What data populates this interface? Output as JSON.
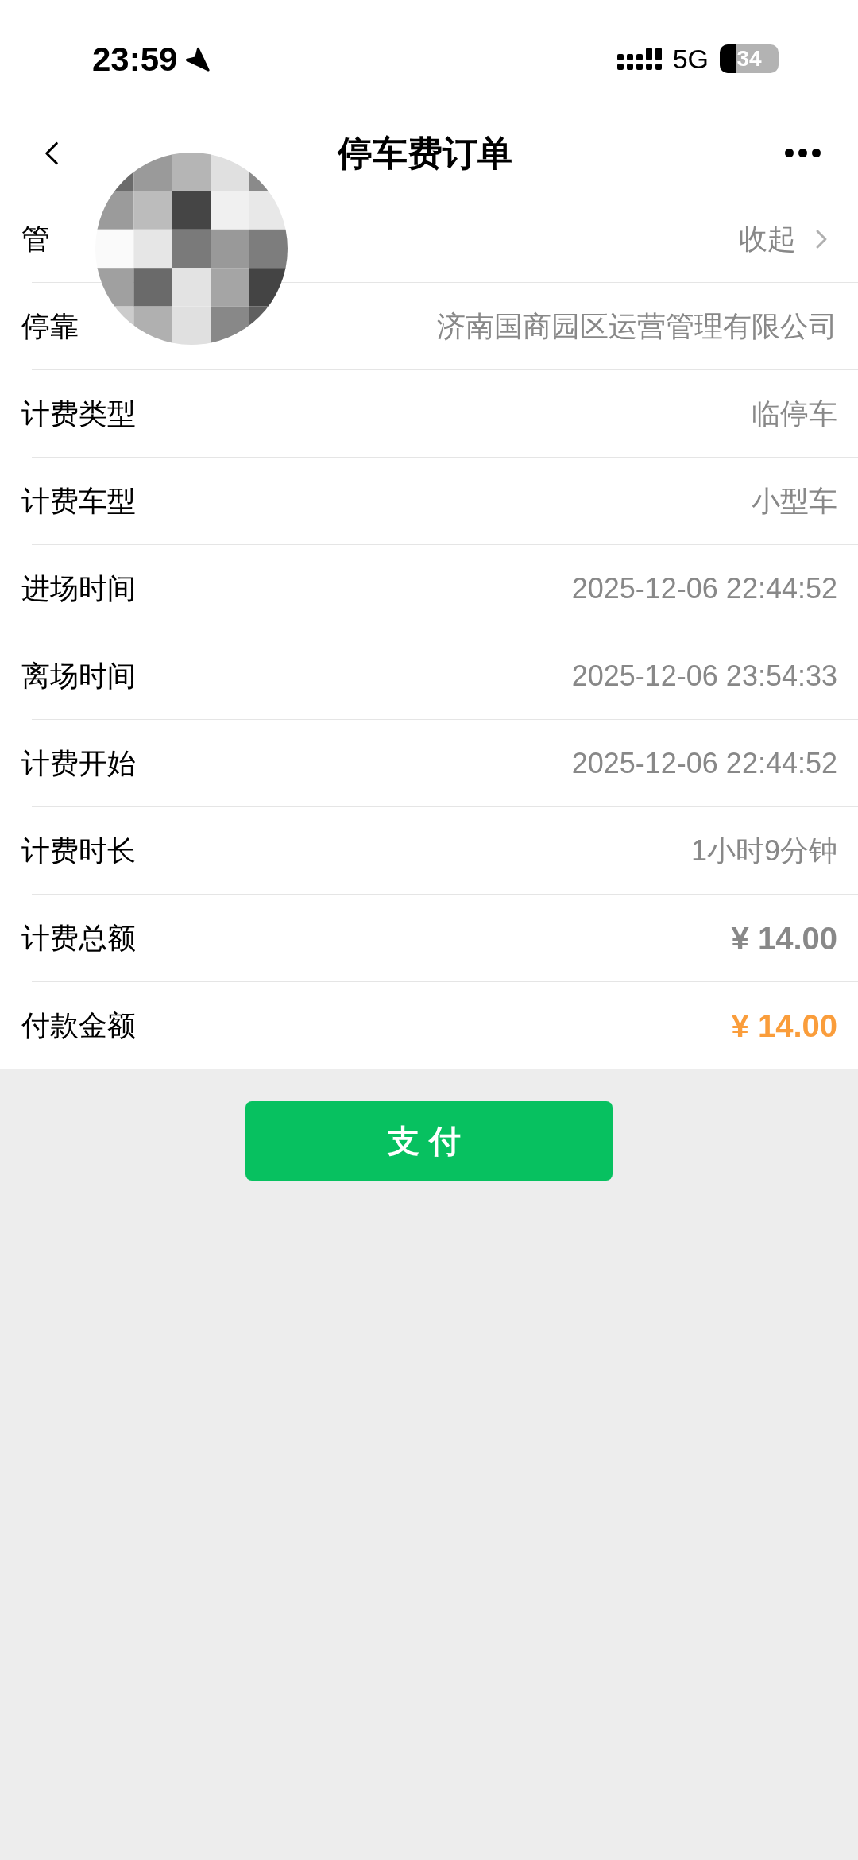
{
  "status_bar": {
    "time": "23:59",
    "network": "5G",
    "battery": "34"
  },
  "nav": {
    "title": "停车费订单"
  },
  "rows": [
    {
      "label": "管",
      "value": "收起",
      "kind": "toggle"
    },
    {
      "label": "停靠",
      "value": "济南国商园区运营管理有限公司",
      "kind": "plain"
    },
    {
      "label": "计费类型",
      "value": "临停车",
      "kind": "plain"
    },
    {
      "label": "计费车型",
      "value": "小型车",
      "kind": "plain"
    },
    {
      "label": "进场时间",
      "value": "2025-12-06 22:44:52",
      "kind": "plain"
    },
    {
      "label": "离场时间",
      "value": "2025-12-06 23:54:33",
      "kind": "plain"
    },
    {
      "label": "计费开始",
      "value": "2025-12-06 22:44:52",
      "kind": "plain"
    },
    {
      "label": "计费时长",
      "value": "1小时9分钟",
      "kind": "plain"
    },
    {
      "label": "计费总额",
      "value": "¥ 14.00",
      "kind": "total"
    },
    {
      "label": "付款金额",
      "value": "¥ 14.00",
      "kind": "pay"
    }
  ],
  "pay_button": "支付"
}
